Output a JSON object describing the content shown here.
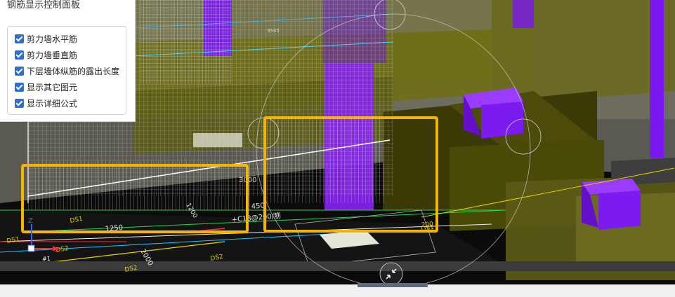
{
  "panel": {
    "title": "钢筋显示控制面板",
    "options": [
      {
        "label": "剪力墙水平筋",
        "checked": true
      },
      {
        "label": "剪力墙垂直筋",
        "checked": true
      },
      {
        "label": "下层墙体纵筋的露出长度",
        "checked": true
      },
      {
        "label": "显示其它图元",
        "checked": true
      },
      {
        "label": "显示详细公式",
        "checked": true
      }
    ]
  },
  "scene": {
    "dims": [
      "9585",
      "3000",
      "1250",
      "2000",
      "450",
      "200",
      "1200"
    ],
    "rebar_label": "+C18@200/筋",
    "pile_labels": [
      "DS1",
      "DS2",
      "DS2",
      "DS2",
      "DS1",
      "DS1"
    ],
    "axis_x": "X",
    "axis_z": "Z",
    "axis_index": "#1"
  },
  "colors": {
    "highlight": "#f5b400",
    "olive": "#6f6e12",
    "purple": "#7a18f0",
    "cad_black": "#0b0b0b"
  },
  "icons": {
    "collapse": "collapse-arrows-icon",
    "axis": "axis-gizmo-icon"
  }
}
